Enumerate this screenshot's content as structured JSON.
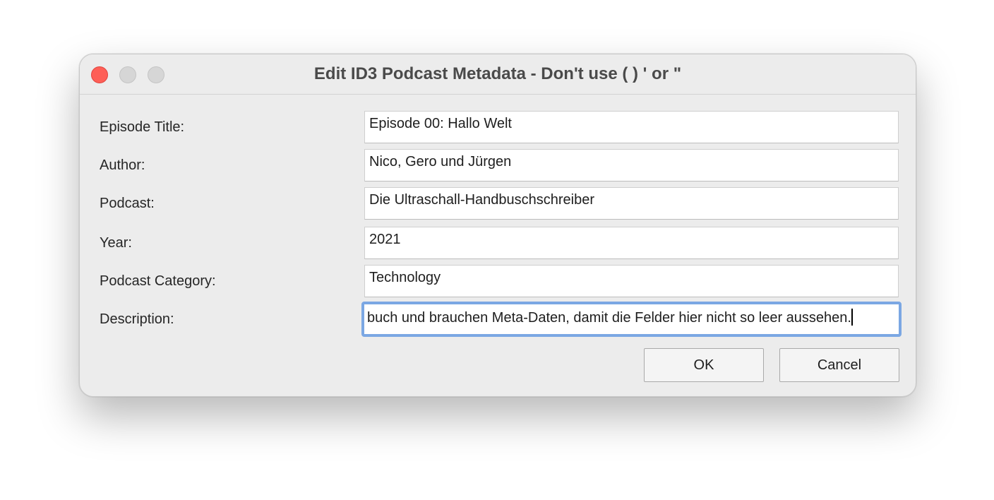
{
  "window": {
    "title": "Edit ID3 Podcast Metadata - Don't use ( ) ' or \"",
    "traffic_lights": [
      "close",
      "minimize",
      "zoom"
    ]
  },
  "form": {
    "fields": [
      {
        "label": "Episode Title:",
        "value": "Episode 00: Hallo Welt"
      },
      {
        "label": "Author:",
        "value": "Nico, Gero und Jürgen"
      },
      {
        "label": "Podcast:",
        "value": "Die Ultraschall-Handbuschschreiber"
      },
      {
        "label": "Year:",
        "value": "2021"
      },
      {
        "label": "Podcast Category:",
        "value": "Technology"
      },
      {
        "label": "Description:",
        "value": "buch und brauchen Meta-Daten, damit die Felder hier nicht so leer aussehen."
      }
    ],
    "focused_field": "Description:"
  },
  "buttons": {
    "ok_label": "OK",
    "cancel_label": "Cancel"
  },
  "colors": {
    "close": "#fe5f57",
    "focus_ring": "#7ba7e3",
    "window_bg": "#ececec"
  }
}
